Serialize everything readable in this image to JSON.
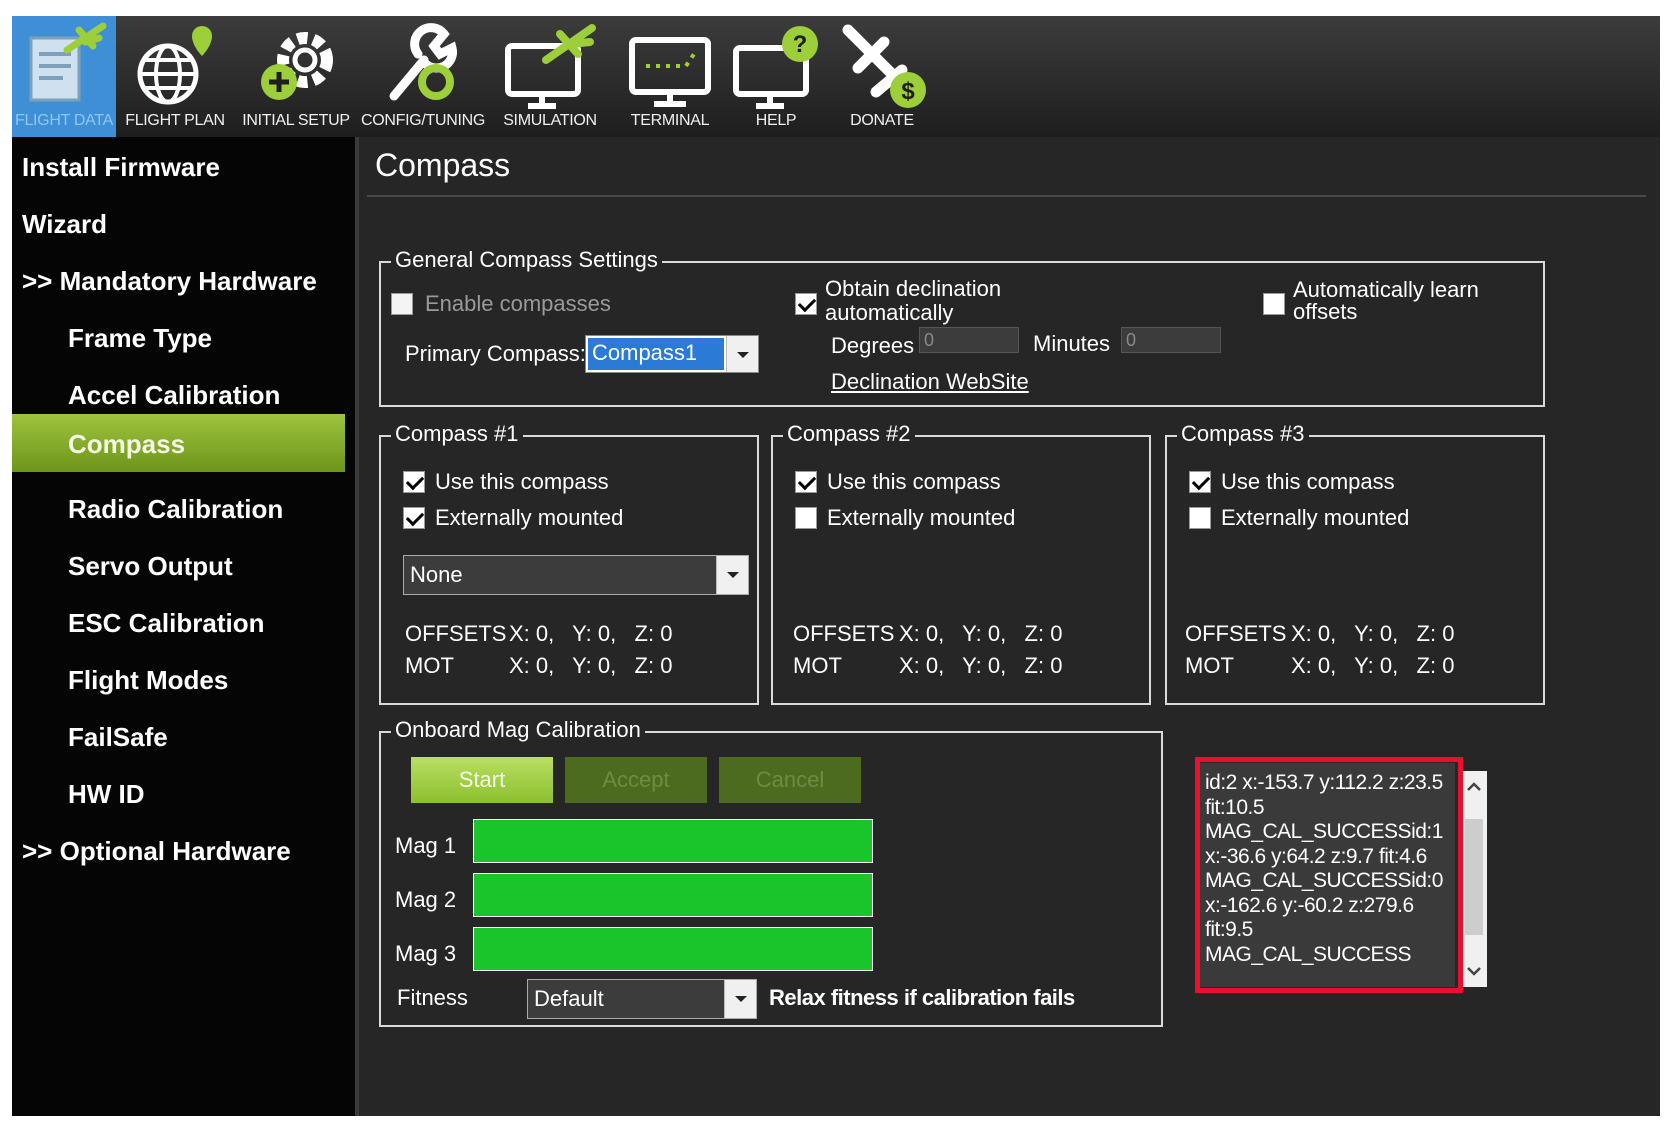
{
  "toolbar": {
    "items": [
      {
        "label": "FLIGHT DATA",
        "icon": "flight-data-icon",
        "active": true
      },
      {
        "label": "FLIGHT PLAN",
        "icon": "flight-plan-icon"
      },
      {
        "label": "INITIAL SETUP",
        "icon": "initial-setup-icon"
      },
      {
        "label": "CONFIG/TUNING",
        "icon": "config-tuning-icon"
      },
      {
        "label": "SIMULATION",
        "icon": "simulation-icon"
      },
      {
        "label": "TERMINAL",
        "icon": "terminal-icon"
      },
      {
        "label": "HELP",
        "icon": "help-icon"
      },
      {
        "label": "DONATE",
        "icon": "donate-icon"
      }
    ]
  },
  "sidebar": {
    "items": [
      {
        "label": "Install Firmware",
        "kind": "section"
      },
      {
        "label": "Wizard",
        "kind": "section"
      },
      {
        "label": ">> Mandatory Hardware",
        "kind": "section"
      },
      {
        "label": "Frame Type",
        "kind": "sub"
      },
      {
        "label": "Accel Calibration",
        "kind": "sub"
      },
      {
        "label": "Compass",
        "kind": "sub",
        "active": true
      },
      {
        "label": "Radio Calibration",
        "kind": "sub"
      },
      {
        "label": "Servo Output",
        "kind": "sub"
      },
      {
        "label": "ESC Calibration",
        "kind": "sub"
      },
      {
        "label": "Flight Modes",
        "kind": "sub"
      },
      {
        "label": "FailSafe",
        "kind": "sub"
      },
      {
        "label": "HW ID",
        "kind": "sub"
      },
      {
        "label": ">> Optional Hardware",
        "kind": "section"
      }
    ]
  },
  "page": {
    "title": "Compass"
  },
  "general": {
    "legend": "General Compass Settings",
    "enable_label": "Enable compasses",
    "primary_label": "Primary Compass:",
    "primary_value": "Compass1",
    "declination_label": "Obtain declination automatically",
    "degrees_label": "Degrees",
    "degrees_value": "0",
    "minutes_label": "Minutes",
    "minutes_value": "0",
    "website_link": "Declination WebSite",
    "autolearn_label": "Automatically learn offsets"
  },
  "compasses": [
    {
      "legend": "Compass #1",
      "use_label": "Use this compass",
      "use": true,
      "ext_label": "Externally mounted",
      "ext": true,
      "orientation": "None",
      "offsets_label": "OFFSETS",
      "offsets": "X: 0,   Y: 0,   Z: 0",
      "mot_label": "MOT",
      "mot": "X: 0,   Y: 0,   Z: 0"
    },
    {
      "legend": "Compass #2",
      "use_label": "Use this compass",
      "use": true,
      "ext_label": "Externally mounted",
      "ext": false,
      "offsets_label": "OFFSETS",
      "offsets": "X: 0,   Y: 0,   Z: 0",
      "mot_label": "MOT",
      "mot": "X: 0,   Y: 0,   Z: 0"
    },
    {
      "legend": "Compass #3",
      "use_label": "Use this compass",
      "use": true,
      "ext_label": "Externally mounted",
      "ext": false,
      "offsets_label": "OFFSETS",
      "offsets": "X: 0,   Y: 0,   Z: 0",
      "mot_label": "MOT",
      "mot": "X: 0,   Y: 0,   Z: 0"
    }
  ],
  "onboard": {
    "legend": "Onboard Mag Calibration",
    "start_label": "Start",
    "accept_label": "Accept",
    "cancel_label": "Cancel",
    "mag_labels": [
      "Mag 1",
      "Mag 2",
      "Mag 3"
    ],
    "mag_progress": [
      1.0,
      1.0,
      1.0
    ],
    "fitness_label": "Fitness",
    "fitness_value": "Default",
    "relax_label": "Relax fitness if calibration fails",
    "log_lines": [
      "id:2 x:-153.7 y:112.2 z:23.5",
      "fit:10.5",
      "MAG_CAL_SUCCESSid:1",
      "x:-36.6 y:64.2 z:9.7 fit:4.6",
      "MAG_CAL_SUCCESSid:0",
      "x:-162.6 y:-60.2 z:279.6",
      "fit:9.5",
      "MAG_CAL_SUCCESS"
    ]
  },
  "colors": {
    "accent_green": "#8db52e",
    "progress_green": "#1ac42b",
    "highlight_red": "#e8102e",
    "active_tab": "#3f8fd6"
  }
}
